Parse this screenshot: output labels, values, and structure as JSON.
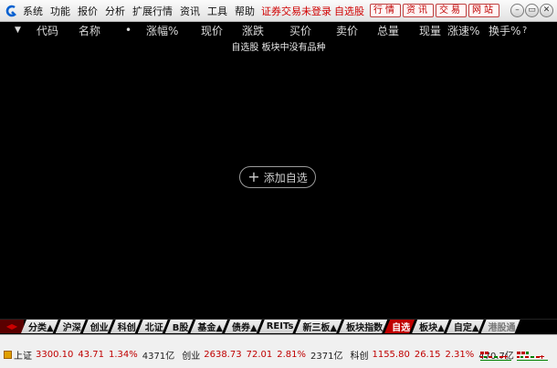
{
  "menu": {
    "items": [
      "系统",
      "功能",
      "报价",
      "分析",
      "扩展行情",
      "资讯",
      "工具",
      "帮助"
    ],
    "trade_status": "证券交易未登录",
    "watchlist_link": "自选股",
    "buttons": [
      "行情",
      "资讯",
      "交易",
      "网站"
    ]
  },
  "header": {
    "arrow": "▼",
    "columns": [
      "代码",
      "名称",
      "•",
      "涨幅%",
      "现价",
      "涨跌",
      "买价",
      "卖价",
      "总量",
      "现量",
      "涨速%",
      "换手%",
      "?"
    ]
  },
  "main": {
    "empty_message": "自选股 板块中没有品种",
    "add_button_plus": "+",
    "add_button_label": "添加自选"
  },
  "tabs": [
    {
      "label": "分类▲",
      "active": false
    },
    {
      "label": "沪深",
      "active": false
    },
    {
      "label": "创业",
      "active": false
    },
    {
      "label": "科创",
      "active": false
    },
    {
      "label": "北证",
      "active": false
    },
    {
      "label": "B股",
      "active": false
    },
    {
      "label": "基金▲",
      "active": false
    },
    {
      "label": "债券▲",
      "active": false
    },
    {
      "label": "REITs",
      "active": false
    },
    {
      "label": "新三板▲",
      "active": false
    },
    {
      "label": "板块指数",
      "active": false
    },
    {
      "label": "自选",
      "active": true
    },
    {
      "label": "板块▲",
      "active": false
    },
    {
      "label": "自定▲",
      "active": false
    },
    {
      "label": "港股通",
      "active": false
    }
  ],
  "status": {
    "sh": {
      "name": "上证",
      "price": "3300.10",
      "change": "43.71",
      "pct": "1.34%",
      "amount": "4371亿"
    },
    "cy": {
      "name": "创业",
      "price": "2638.73",
      "change": "72.01",
      "pct": "2.81%",
      "amount": "2371亿"
    },
    "kc": {
      "name": "科创",
      "price": "1155.80",
      "change": "26.15",
      "pct": "2.31%",
      "amount": "470.7亿"
    }
  },
  "colors": {
    "up": "#c00000",
    "active_tab": "#c00000",
    "menu_link": "#d00000"
  }
}
